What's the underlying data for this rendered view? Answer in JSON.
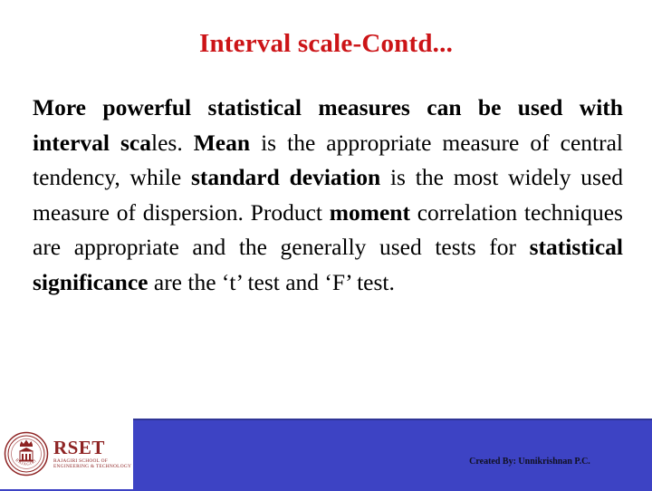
{
  "slide": {
    "title": "Interval scale-Contd...",
    "title_color": "#cc1417",
    "background_color": "#ffffff",
    "body_runs": [
      {
        "text": "More powerful statistical measures can be used with interval sca",
        "bold": true
      },
      {
        "text": "les. ",
        "bold": false
      },
      {
        "text": "Mean",
        "bold": true
      },
      {
        "text": " is the appropriate measure of central tendency, while ",
        "bold": false
      },
      {
        "text": "standard deviation",
        "bold": true
      },
      {
        "text": " is the most widely used measure of dispersion. Product ",
        "bold": false
      },
      {
        "text": "moment",
        "bold": true
      },
      {
        "text": " correlation techniques are appropriate and the generally used tests for ",
        "bold": false
      },
      {
        "text": "statistical significance",
        "bold": true
      },
      {
        "text": " are the ‘t’ test and ‘F’ test.",
        "bold": false
      }
    ]
  },
  "footer": {
    "band_color": "#3d43c4",
    "credit": "Created By: Unnikrishnan P.C.",
    "logo": {
      "name": "RSET",
      "subtitle_line1": "RAJAGIRI SCHOOL OF",
      "subtitle_line2": "ENGINEERING & TECHNOLOGY",
      "seal_color": "#8e2323",
      "seal_text": "RAJAGIRI"
    }
  }
}
